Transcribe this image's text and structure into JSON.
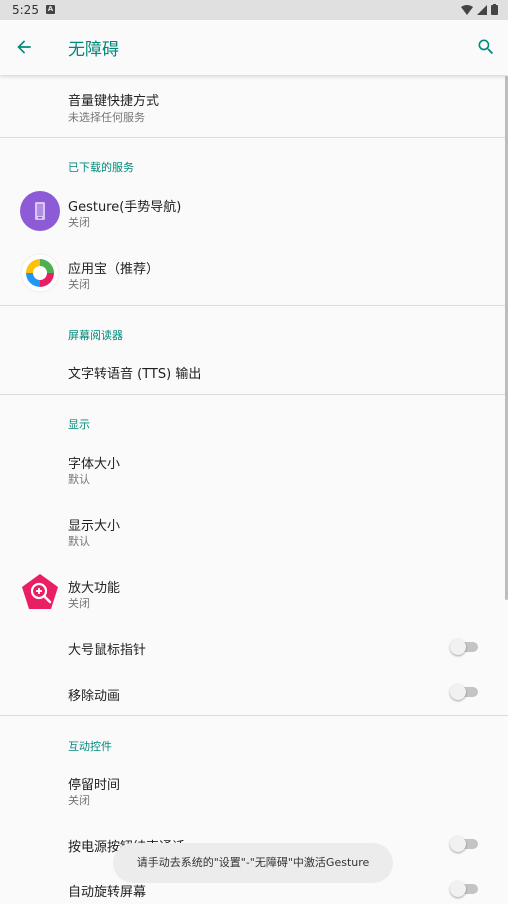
{
  "status_bar": {
    "time": "5:25",
    "notif_icon": "A"
  },
  "app_bar": {
    "title": "无障碍"
  },
  "sections": {
    "volume_shortcut": {
      "title": "音量键快捷方式",
      "summary": "未选择任何服务"
    },
    "downloaded": {
      "header": "已下载的服务",
      "gesture": {
        "title": "Gesture(手势导航)",
        "summary": "关闭"
      },
      "yingyongbao": {
        "title": "应用宝（推荐）",
        "summary": "关闭"
      }
    },
    "screen_reader": {
      "header": "屏幕阅读器",
      "tts": {
        "title": "文字转语音 (TTS) 输出"
      }
    },
    "display": {
      "header": "显示",
      "font_size": {
        "title": "字体大小",
        "summary": "默认"
      },
      "display_size": {
        "title": "显示大小",
        "summary": "默认"
      },
      "magnification": {
        "title": "放大功能",
        "summary": "关闭"
      },
      "large_pointer": {
        "title": "大号鼠标指针"
      },
      "remove_animation": {
        "title": "移除动画"
      }
    },
    "interaction": {
      "header": "互动控件",
      "dwell_time": {
        "title": "停留时间",
        "summary": "关闭"
      },
      "power_end_call": {
        "title": "按电源按钮结束通话"
      },
      "auto_rotate": {
        "title": "自动旋转屏幕"
      }
    }
  },
  "toast": {
    "message": "请手动去系统的\"设置\"-\"无障碍\"中激活Gesture"
  },
  "colors": {
    "accent": "#00897b",
    "gesture_icon": "#8e5bd6",
    "magnify_icon": "#e91e63"
  }
}
